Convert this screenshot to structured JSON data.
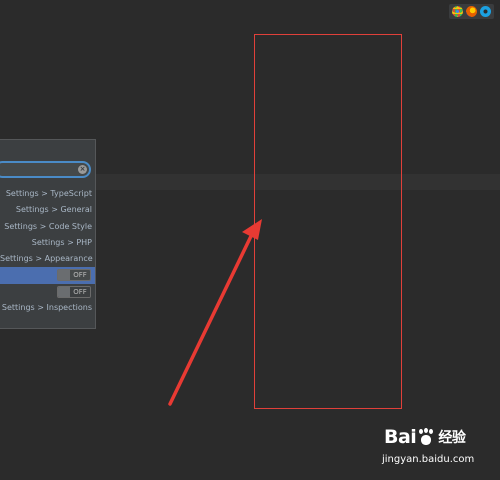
{
  "browser_icons": [
    "chrome-icon",
    "firefox-icon",
    "ie-icon"
  ],
  "search_popup": {
    "query": "",
    "results": [
      {
        "label": "Settings > TypeScript",
        "selected": false,
        "toggle": null
      },
      {
        "label": "Settings > General",
        "selected": false,
        "toggle": null
      },
      {
        "label": "Settings > Code Style",
        "selected": false,
        "toggle": null
      },
      {
        "label": "Settings > PHP",
        "selected": false,
        "toggle": null
      },
      {
        "label": "Settings > Appearance",
        "selected": false,
        "toggle": null
      },
      {
        "label": "",
        "selected": true,
        "toggle": "OFF"
      },
      {
        "label": "",
        "selected": false,
        "toggle": "OFF"
      },
      {
        "label": "Settings > Inspections",
        "selected": false,
        "toggle": null
      }
    ]
  },
  "annotation": {
    "color": "#e0403a"
  },
  "watermark": {
    "brand_left": "Bai",
    "brand_right": "经验",
    "url": "jingyan.baidu.com"
  },
  "colors": {
    "background": "#2b2b2b",
    "selection": "#4b6eaf",
    "focus_border": "#4a8bc7"
  }
}
